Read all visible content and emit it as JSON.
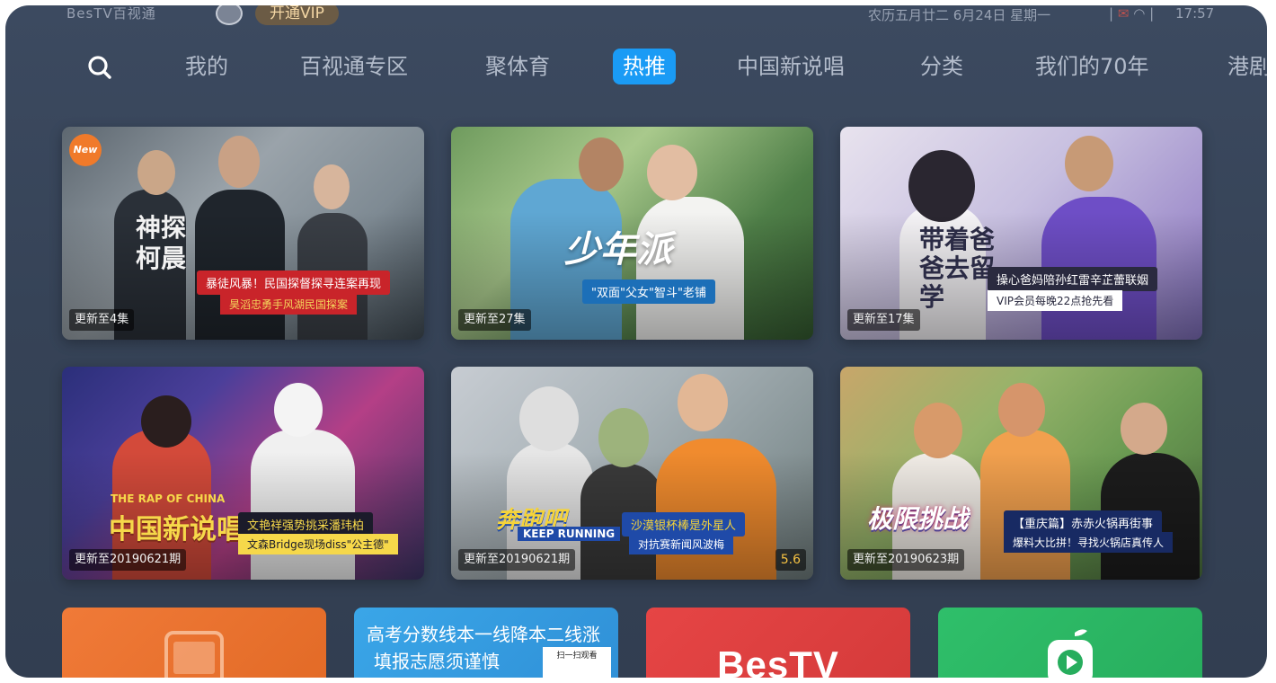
{
  "status": {
    "brand": "BesTV百视通",
    "vip_button": "开通VIP",
    "datetime": "农历五月廿二 6月24日 星期一",
    "clock": "17:57"
  },
  "nav": {
    "tabs": [
      {
        "label": "我的"
      },
      {
        "label": "百视通专区"
      },
      {
        "label": "聚体育"
      },
      {
        "label": "热推"
      },
      {
        "label": "中国新说唱"
      },
      {
        "label": "分类"
      },
      {
        "label": "我们的70年"
      },
      {
        "label": "港剧"
      }
    ],
    "active_tab": "热推"
  },
  "cards": [
    {
      "title_art": "神探柯晨",
      "caption_line1": "暴徒风暴！民国探督探寻连案再现",
      "caption_line2": "昊滔忠勇手风湖民国探案",
      "episode": "更新至4集",
      "badge": "New"
    },
    {
      "title_art": "少年派",
      "caption_line1": "\"双面\"父女\"智斗\"老铺",
      "caption_line2": "",
      "episode": "更新至27集"
    },
    {
      "title_art": "带着爸爸去留学",
      "caption_line1": "操心爸妈陪孙红雷辛芷蕾联姻",
      "caption_line2": "VIP会员每晚22点抢先看",
      "episode": "更新至17集"
    },
    {
      "title_art": "中国新说唱",
      "title_art_en": "THE RAP OF CHINA",
      "caption_line1": "文艳祥强势挑采潘玮柏",
      "caption_line2": "文森Bridge现场diss\"公主德\"",
      "episode": "更新至20190621期"
    },
    {
      "title_art": "奔跑吧",
      "title_art_en": "KEEP RUNNING",
      "caption_line1": "沙漠银杯棒是外星人",
      "caption_line2": "对抗赛新闻风波梅",
      "episode": "更新至20190621期",
      "score": "5.6"
    },
    {
      "title_art": "极限挑战",
      "caption_line1": "【重庆篇】赤赤火锅再街事",
      "caption_line2": "爆料大比拼！寻找火锅店真传人",
      "episode": "更新至20190623期"
    }
  ],
  "tiles": [
    {
      "name": "orange-app"
    },
    {
      "line1": "高考分数线本一线降本二线涨",
      "line2": "填报志愿须谨慎",
      "qr_label": "扫一扫观看"
    },
    {
      "logo": "BesTV"
    },
    {
      "name": "green-app"
    }
  ],
  "colors": {
    "accent": "#1a9bf5",
    "background": "#364357",
    "vip_gold": "#f3d6a4"
  }
}
